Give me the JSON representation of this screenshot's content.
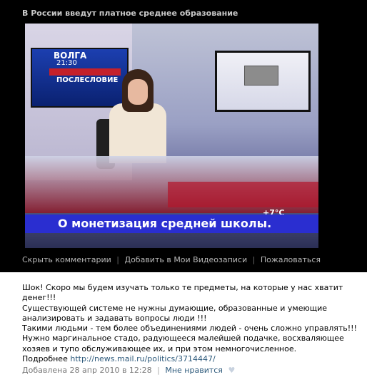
{
  "video": {
    "title": "В России введут платное среднее образование",
    "screen_left": {
      "line1": "ВОЛГА",
      "line2": "21:30",
      "line3": "ПОСЛЕСЛОВИЕ"
    },
    "temperature": "+7°C",
    "ticker_text": "О монетизация средней школы."
  },
  "controls": {
    "hide_comments": "Скрыть комментарии",
    "add_to_videos": "Добавить в Мои Видеозаписи",
    "report": "Пожаловаться"
  },
  "description": {
    "paragraph1": "Шок! Скоро мы будем изучать только те предметы, на которые у нас хватит денег!!!",
    "paragraph2": "Существующей системе не нужны думающие, образованные и умеющие анализировать и задавать вопросы люди !!!",
    "paragraph3": "Такими людьми - тем более объединениями людей - очень сложно управлять!!!",
    "paragraph4": "Нужно маргинальное стадо, радующееся малейшей подачке, восхваляющее хозяев и тупо обслуживающее их, и при этом немногочисленное.",
    "more_label": "Подробнее",
    "more_link": "http://news.mail.ru/politics/3714447/"
  },
  "footer": {
    "added": "Добавлена 28 апр 2010 в 12:28",
    "like_label": "Мне нравится",
    "heart_icon": "heart-icon"
  }
}
